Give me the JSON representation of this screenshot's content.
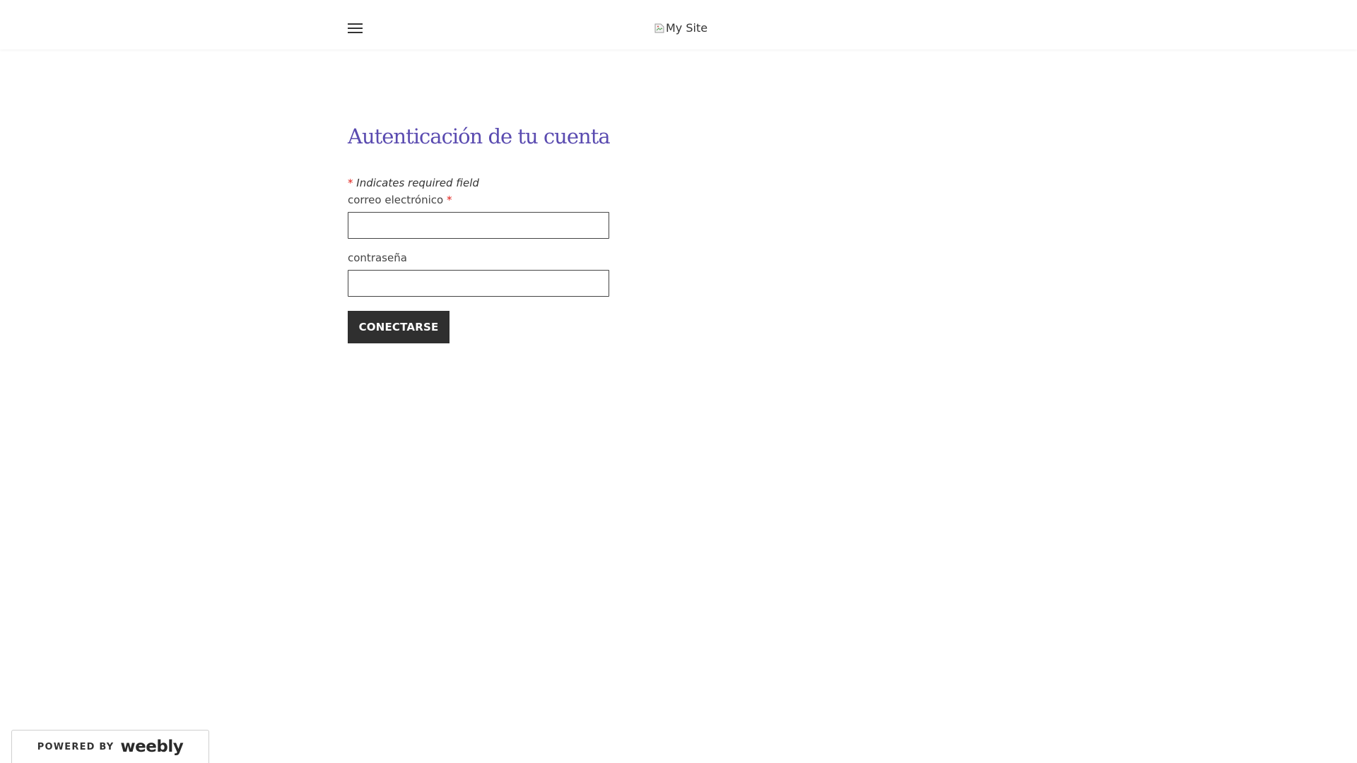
{
  "header": {
    "menu_icon": "hamburger-menu-icon",
    "logo_alt_text": "My Site",
    "logo_icon": "broken-image-icon"
  },
  "form": {
    "title": "Autenticación de tu cuenta",
    "required_star": "*",
    "required_note": "Indicates required field",
    "email_label": "correo electrónico",
    "email_value": "",
    "password_label": "contraseña",
    "password_value": "",
    "submit_label": "CONECTARSE"
  },
  "footer": {
    "powered_by": "POWERED BY",
    "brand": "weebly"
  },
  "colors": {
    "title": "#5a4bb0",
    "required_star": "#e0201b",
    "button_bg": "#2f2f2f",
    "button_text": "#ffffff"
  }
}
